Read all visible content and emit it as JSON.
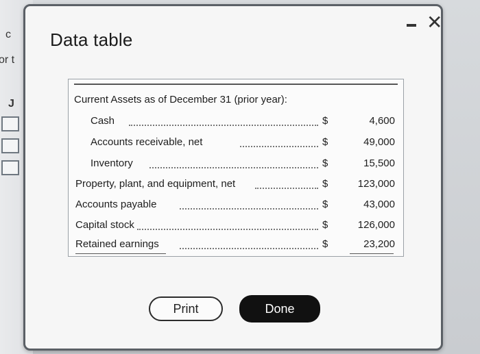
{
  "dialog": {
    "title": "Data table",
    "minimize_icon": "minimize-icon",
    "close_icon": "close-icon",
    "close_glyph": "✕"
  },
  "background": {
    "fragment_1": "c",
    "fragment_2": "or t",
    "fragment_3": "J"
  },
  "table": {
    "heading": "Current Assets as of December 31 (prior year):",
    "rows": [
      {
        "label": "Cash",
        "currency": "$",
        "value": "4,600"
      },
      {
        "label": "Accounts receivable, net",
        "currency": "$",
        "value": "49,000"
      },
      {
        "label": "Inventory",
        "currency": "$",
        "value": "15,500"
      },
      {
        "label": "Property, plant, and equipment, net",
        "currency": "$",
        "value": "123,000"
      },
      {
        "label": "Accounts payable",
        "currency": "$",
        "value": "43,000"
      },
      {
        "label": "Capital stock",
        "currency": "$",
        "value": "126,000"
      },
      {
        "label": "Retained earnings",
        "currency": "$",
        "value": "23,200"
      }
    ]
  },
  "buttons": {
    "print_label": "Print",
    "done_label": "Done"
  }
}
